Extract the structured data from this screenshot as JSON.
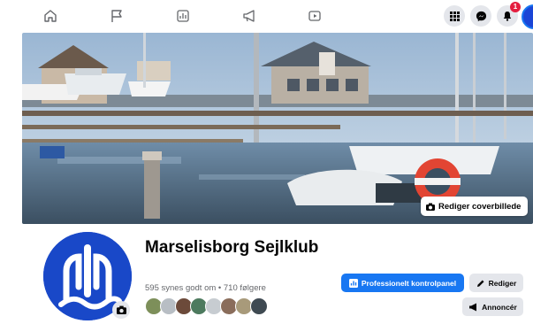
{
  "nav": {
    "icons": [
      "home-icon",
      "flag-icon",
      "insights-icon",
      "megaphone-icon",
      "video-icon"
    ],
    "notification_count": "1"
  },
  "cover": {
    "edit_label": "Rediger coverbillede",
    "caption": "Harbor with moored boats and clubhouse in winter"
  },
  "page": {
    "name": "Marselisborg Sejlklub",
    "stats": "595 synes godt om • 710 følgere"
  },
  "actions": {
    "dashboard_label": "Professionelt kontrolpanel",
    "edit_label": "Rediger",
    "advertise_label": "Annoncér"
  },
  "colors": {
    "accent": "#1877f2",
    "brand_blue": "#1948c8",
    "badge_red": "#e41e3f"
  }
}
